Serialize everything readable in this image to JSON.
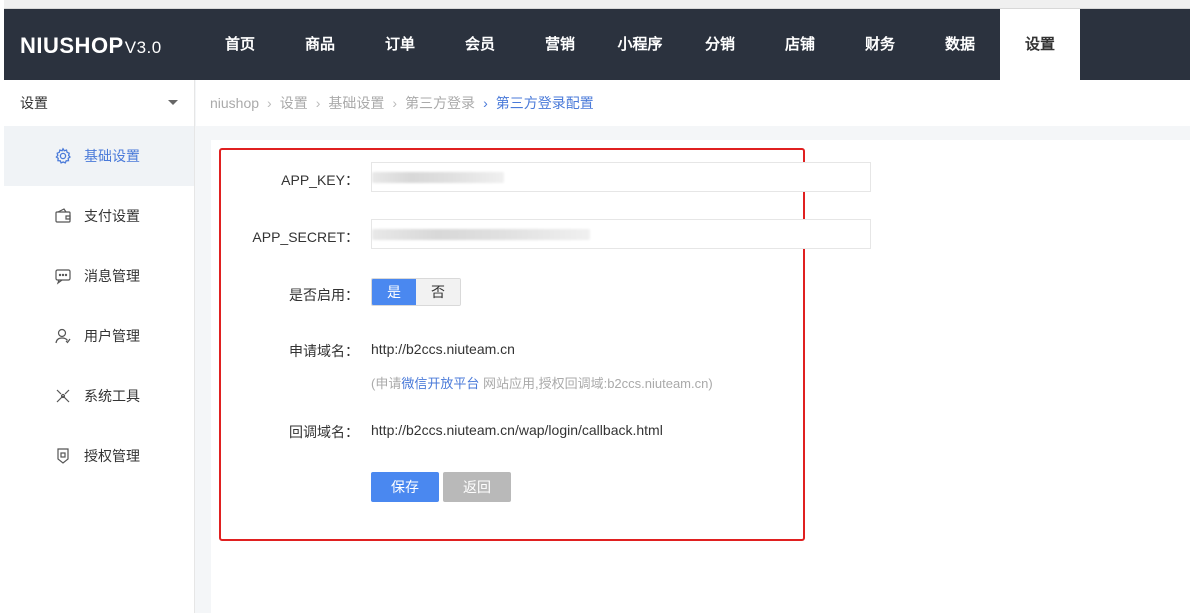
{
  "brand": {
    "name": "NIUSHOP",
    "version": "V3.0"
  },
  "nav": [
    {
      "label": "首页"
    },
    {
      "label": "商品"
    },
    {
      "label": "订单"
    },
    {
      "label": "会员"
    },
    {
      "label": "营销"
    },
    {
      "label": "小程序"
    },
    {
      "label": "分销"
    },
    {
      "label": "店铺"
    },
    {
      "label": "财务"
    },
    {
      "label": "数据"
    },
    {
      "label": "设置",
      "active": true
    }
  ],
  "sidebar": {
    "header": "设置",
    "items": [
      {
        "label": "基础设置",
        "icon": "gear-icon",
        "active": true
      },
      {
        "label": "支付设置",
        "icon": "wallet-icon"
      },
      {
        "label": "消息管理",
        "icon": "message-icon"
      },
      {
        "label": "用户管理",
        "icon": "user-icon"
      },
      {
        "label": "系统工具",
        "icon": "tools-icon"
      },
      {
        "label": "授权管理",
        "icon": "license-icon"
      }
    ]
  },
  "breadcrumb": [
    "niushop",
    "设置",
    "基础设置",
    "第三方登录",
    "第三方登录配置"
  ],
  "form": {
    "app_key_label": "APP_KEY：",
    "app_secret_label": "APP_SECRET：",
    "enable_label": "是否启用：",
    "enable_yes": "是",
    "enable_no": "否",
    "domain_label": "申请域名：",
    "domain_value": "http://b2ccs.niuteam.cn",
    "hint_prefix": "(申请",
    "hint_link": "微信开放平台",
    "hint_suffix": " 网站应用,授权回调域:b2ccs.niuteam.cn)",
    "callback_label": "回调域名：",
    "callback_value": "http://b2ccs.niuteam.cn/wap/login/callback.html",
    "save_label": "保存",
    "back_label": "返回"
  },
  "colors": {
    "accent": "#4a88f0",
    "topbar": "#2b323e",
    "highlight_border": "#e02020"
  }
}
